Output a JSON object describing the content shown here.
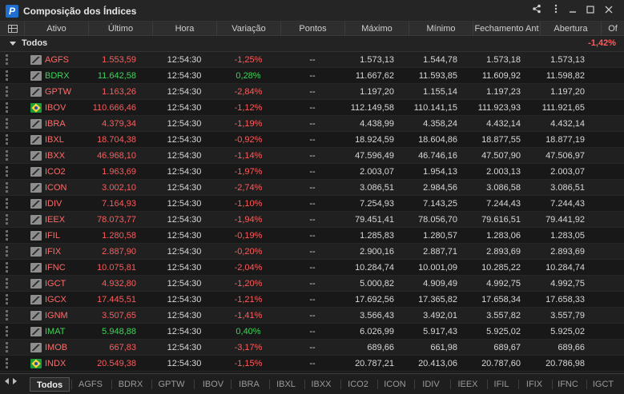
{
  "window": {
    "title": "Composição dos Índices",
    "logo_letter": "P"
  },
  "columns": [
    "Ativo",
    "Último",
    "Hora",
    "Variação",
    "Pontos",
    "Máximo",
    "Mínimo",
    "Fechamento Ant",
    "Abertura",
    "Of"
  ],
  "group": {
    "name": "Todos",
    "variation": "-1,42%"
  },
  "colors": {
    "negative": "#ff5b5b",
    "positive": "#3fd45a",
    "accent": "#1e6fd0"
  },
  "rows": [
    {
      "ativo": "AGFS",
      "ultimo": "1.553,59",
      "hora": "12:54:30",
      "variacao": "-1,25%",
      "pontos": "--",
      "maximo": "1.573,13",
      "minimo": "1.544,78",
      "fechamento": "1.573,18",
      "abertura": "1.573,13",
      "dir": "neg",
      "icon": "chart-icon"
    },
    {
      "ativo": "BDRX",
      "ultimo": "11.642,58",
      "hora": "12:54:30",
      "variacao": "0,28%",
      "pontos": "--",
      "maximo": "11.667,62",
      "minimo": "11.593,85",
      "fechamento": "11.609,92",
      "abertura": "11.598,82",
      "dir": "pos",
      "icon": "chart-icon"
    },
    {
      "ativo": "GPTW",
      "ultimo": "1.163,26",
      "hora": "12:54:30",
      "variacao": "-2,84%",
      "pontos": "--",
      "maximo": "1.197,20",
      "minimo": "1.155,14",
      "fechamento": "1.197,23",
      "abertura": "1.197,20",
      "dir": "neg",
      "icon": "chart-icon"
    },
    {
      "ativo": "IBOV",
      "ultimo": "110.666,46",
      "hora": "12:54:30",
      "variacao": "-1,12%",
      "pontos": "--",
      "maximo": "112.149,58",
      "minimo": "110.141,15",
      "fechamento": "111.923,93",
      "abertura": "111.921,65",
      "dir": "neg",
      "icon": "brazil-flag-icon"
    },
    {
      "ativo": "IBRA",
      "ultimo": "4.379,34",
      "hora": "12:54:30",
      "variacao": "-1,19%",
      "pontos": "--",
      "maximo": "4.438,99",
      "minimo": "4.358,24",
      "fechamento": "4.432,14",
      "abertura": "4.432,14",
      "dir": "neg",
      "icon": "chart-icon"
    },
    {
      "ativo": "IBXL",
      "ultimo": "18.704,38",
      "hora": "12:54:30",
      "variacao": "-0,92%",
      "pontos": "--",
      "maximo": "18.924,59",
      "minimo": "18.604,86",
      "fechamento": "18.877,55",
      "abertura": "18.877,19",
      "dir": "neg",
      "icon": "chart-icon"
    },
    {
      "ativo": "IBXX",
      "ultimo": "46.968,10",
      "hora": "12:54:30",
      "variacao": "-1,14%",
      "pontos": "--",
      "maximo": "47.596,49",
      "minimo": "46.746,16",
      "fechamento": "47.507,90",
      "abertura": "47.506,97",
      "dir": "neg",
      "icon": "chart-icon"
    },
    {
      "ativo": "ICO2",
      "ultimo": "1.963,69",
      "hora": "12:54:30",
      "variacao": "-1,97%",
      "pontos": "--",
      "maximo": "2.003,07",
      "minimo": "1.954,13",
      "fechamento": "2.003,13",
      "abertura": "2.003,07",
      "dir": "neg",
      "icon": "chart-icon"
    },
    {
      "ativo": "ICON",
      "ultimo": "3.002,10",
      "hora": "12:54:30",
      "variacao": "-2,74%",
      "pontos": "--",
      "maximo": "3.086,51",
      "minimo": "2.984,56",
      "fechamento": "3.086,58",
      "abertura": "3.086,51",
      "dir": "neg",
      "icon": "chart-icon"
    },
    {
      "ativo": "IDIV",
      "ultimo": "7.164,93",
      "hora": "12:54:30",
      "variacao": "-1,10%",
      "pontos": "--",
      "maximo": "7.254,93",
      "minimo": "7.143,25",
      "fechamento": "7.244,43",
      "abertura": "7.244,43",
      "dir": "neg",
      "icon": "chart-icon"
    },
    {
      "ativo": "IEEX",
      "ultimo": "78.073,77",
      "hora": "12:54:30",
      "variacao": "-1,94%",
      "pontos": "--",
      "maximo": "79.451,41",
      "minimo": "78.056,70",
      "fechamento": "79.616,51",
      "abertura": "79.441,92",
      "dir": "neg",
      "icon": "chart-icon"
    },
    {
      "ativo": "IFIL",
      "ultimo": "1.280,58",
      "hora": "12:54:30",
      "variacao": "-0,19%",
      "pontos": "--",
      "maximo": "1.285,83",
      "minimo": "1.280,57",
      "fechamento": "1.283,06",
      "abertura": "1.283,05",
      "dir": "neg",
      "icon": "chart-icon"
    },
    {
      "ativo": "IFIX",
      "ultimo": "2.887,90",
      "hora": "12:54:30",
      "variacao": "-0,20%",
      "pontos": "--",
      "maximo": "2.900,16",
      "minimo": "2.887,71",
      "fechamento": "2.893,69",
      "abertura": "2.893,69",
      "dir": "neg",
      "icon": "chart-icon"
    },
    {
      "ativo": "IFNC",
      "ultimo": "10.075,81",
      "hora": "12:54:30",
      "variacao": "-2,04%",
      "pontos": "--",
      "maximo": "10.284,74",
      "minimo": "10.001,09",
      "fechamento": "10.285,22",
      "abertura": "10.284,74",
      "dir": "neg",
      "icon": "chart-icon"
    },
    {
      "ativo": "IGCT",
      "ultimo": "4.932,80",
      "hora": "12:54:30",
      "variacao": "-1,20%",
      "pontos": "--",
      "maximo": "5.000,82",
      "minimo": "4.909,49",
      "fechamento": "4.992,75",
      "abertura": "4.992,75",
      "dir": "neg",
      "icon": "chart-icon"
    },
    {
      "ativo": "IGCX",
      "ultimo": "17.445,51",
      "hora": "12:54:30",
      "variacao": "-1,21%",
      "pontos": "--",
      "maximo": "17.692,56",
      "minimo": "17.365,82",
      "fechamento": "17.658,34",
      "abertura": "17.658,33",
      "dir": "neg",
      "icon": "chart-icon"
    },
    {
      "ativo": "IGNM",
      "ultimo": "3.507,65",
      "hora": "12:54:30",
      "variacao": "-1,41%",
      "pontos": "--",
      "maximo": "3.566,43",
      "minimo": "3.492,01",
      "fechamento": "3.557,82",
      "abertura": "3.557,79",
      "dir": "neg",
      "icon": "chart-icon"
    },
    {
      "ativo": "IMAT",
      "ultimo": "5.948,88",
      "hora": "12:54:30",
      "variacao": "0,40%",
      "pontos": "--",
      "maximo": "6.026,99",
      "minimo": "5.917,43",
      "fechamento": "5.925,02",
      "abertura": "5.925,02",
      "dir": "pos",
      "icon": "chart-icon"
    },
    {
      "ativo": "IMOB",
      "ultimo": "667,83",
      "hora": "12:54:30",
      "variacao": "-3,17%",
      "pontos": "--",
      "maximo": "689,66",
      "minimo": "661,98",
      "fechamento": "689,67",
      "abertura": "689,66",
      "dir": "neg",
      "icon": "chart-icon"
    },
    {
      "ativo": "INDX",
      "ultimo": "20.549,38",
      "hora": "12:54:30",
      "variacao": "-1,15%",
      "pontos": "--",
      "maximo": "20.787,21",
      "minimo": "20.413,06",
      "fechamento": "20.787,60",
      "abertura": "20.786,98",
      "dir": "neg",
      "icon": "brazil-flag-icon"
    }
  ],
  "tabs": [
    "Todos",
    "AGFS",
    "BDRX",
    "GPTW",
    "IBOV",
    "IBRA",
    "IBXL",
    "IBXX",
    "ICO2",
    "ICON",
    "IDIV",
    "IEEX",
    "IFIL",
    "IFIX",
    "IFNC",
    "IGCT"
  ],
  "active_tab": "Todos"
}
